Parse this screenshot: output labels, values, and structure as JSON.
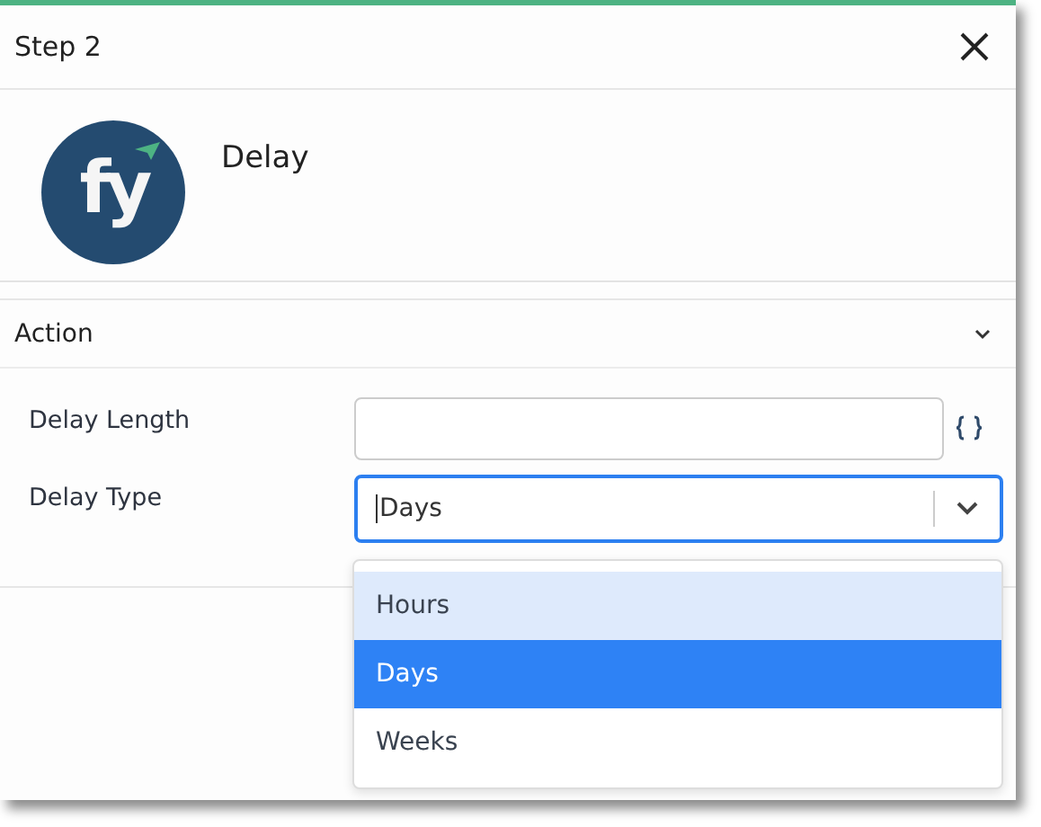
{
  "dialog": {
    "title": "Step 2"
  },
  "step": {
    "logo_text": "fy",
    "name": "Delay"
  },
  "section": {
    "title": "Action",
    "expanded": true
  },
  "fields": [
    {
      "kind": "text",
      "label": "Delay Length"
    },
    {
      "kind": "select",
      "label": "Delay Type",
      "value": "Days",
      "open": true
    }
  ],
  "options": [
    {
      "label": "Hours",
      "hovered": true,
      "selected": false
    },
    {
      "label": "Days",
      "hovered": false,
      "selected": true
    },
    {
      "label": "Weeks",
      "hovered": false,
      "selected": false
    }
  ]
}
